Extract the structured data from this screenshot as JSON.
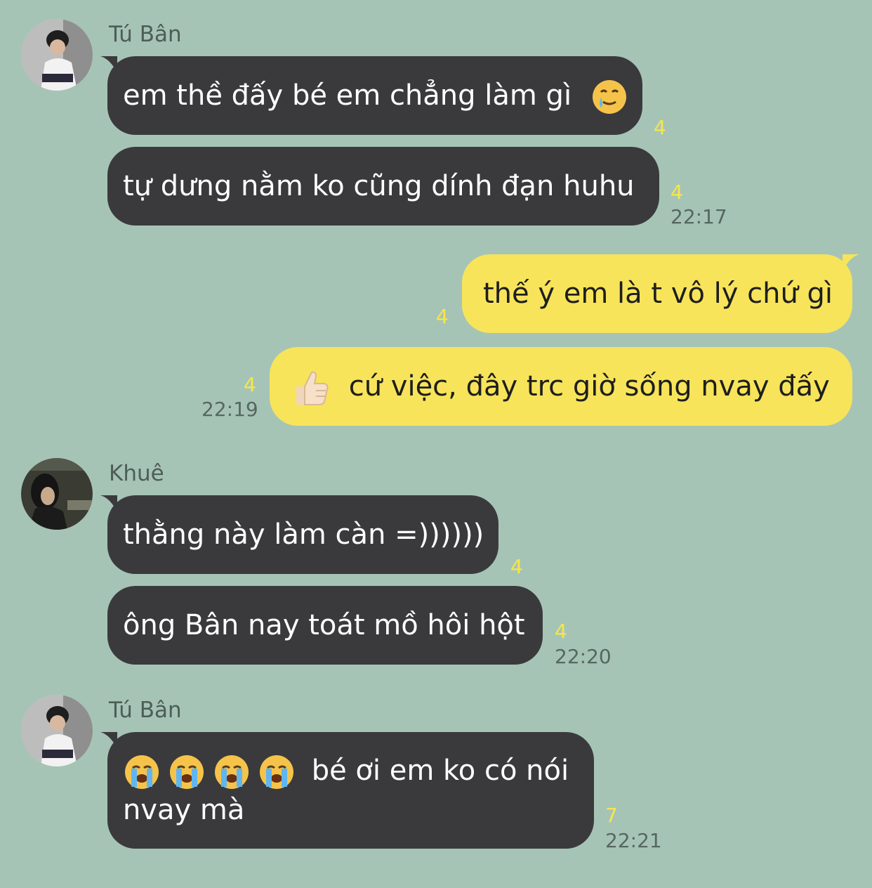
{
  "colors": {
    "background": "#a6c4b6",
    "incoming_bubble": "#3a3a3c",
    "outgoing_bubble": "#f7e45a",
    "unread_count": "#f6e64e",
    "timestamp": "#566760"
  },
  "groups": [
    {
      "sender": "Tú Bân",
      "avatar": "avatar-tu-ban",
      "messages": [
        {
          "text": "em thề đấy bé em chẳng làm gì",
          "emoji": "crying-smile-emoji",
          "unread": "4"
        },
        {
          "text": "tự dưng nằm ko cũng dính đạn huhu",
          "unread": "4",
          "time": "22:17"
        }
      ]
    },
    {
      "sender": "me",
      "messages": [
        {
          "text": "thế ý em là t vô lý chứ gì",
          "unread": "4"
        },
        {
          "text": "cứ việc, đây trc giờ sống nvay đấy",
          "emoji": "thumbs-up-emoji",
          "unread": "4",
          "time": "22:19"
        }
      ]
    },
    {
      "sender": "Khuê",
      "avatar": "avatar-khue",
      "messages": [
        {
          "text": "thằng này làm càn =))))))",
          "unread": "4"
        },
        {
          "text": "ông Bân nay toát mồ hôi hột",
          "unread": "4",
          "time": "22:20"
        }
      ]
    },
    {
      "sender": "Tú Bân",
      "avatar": "avatar-tu-ban",
      "messages": [
        {
          "text_line1": "bé ơi em ko có nói",
          "text_line2": "nvay mà",
          "emoji": "loudly-crying-emoji",
          "emoji_count": 4,
          "unread": "7",
          "time": "22:21"
        }
      ]
    }
  ]
}
